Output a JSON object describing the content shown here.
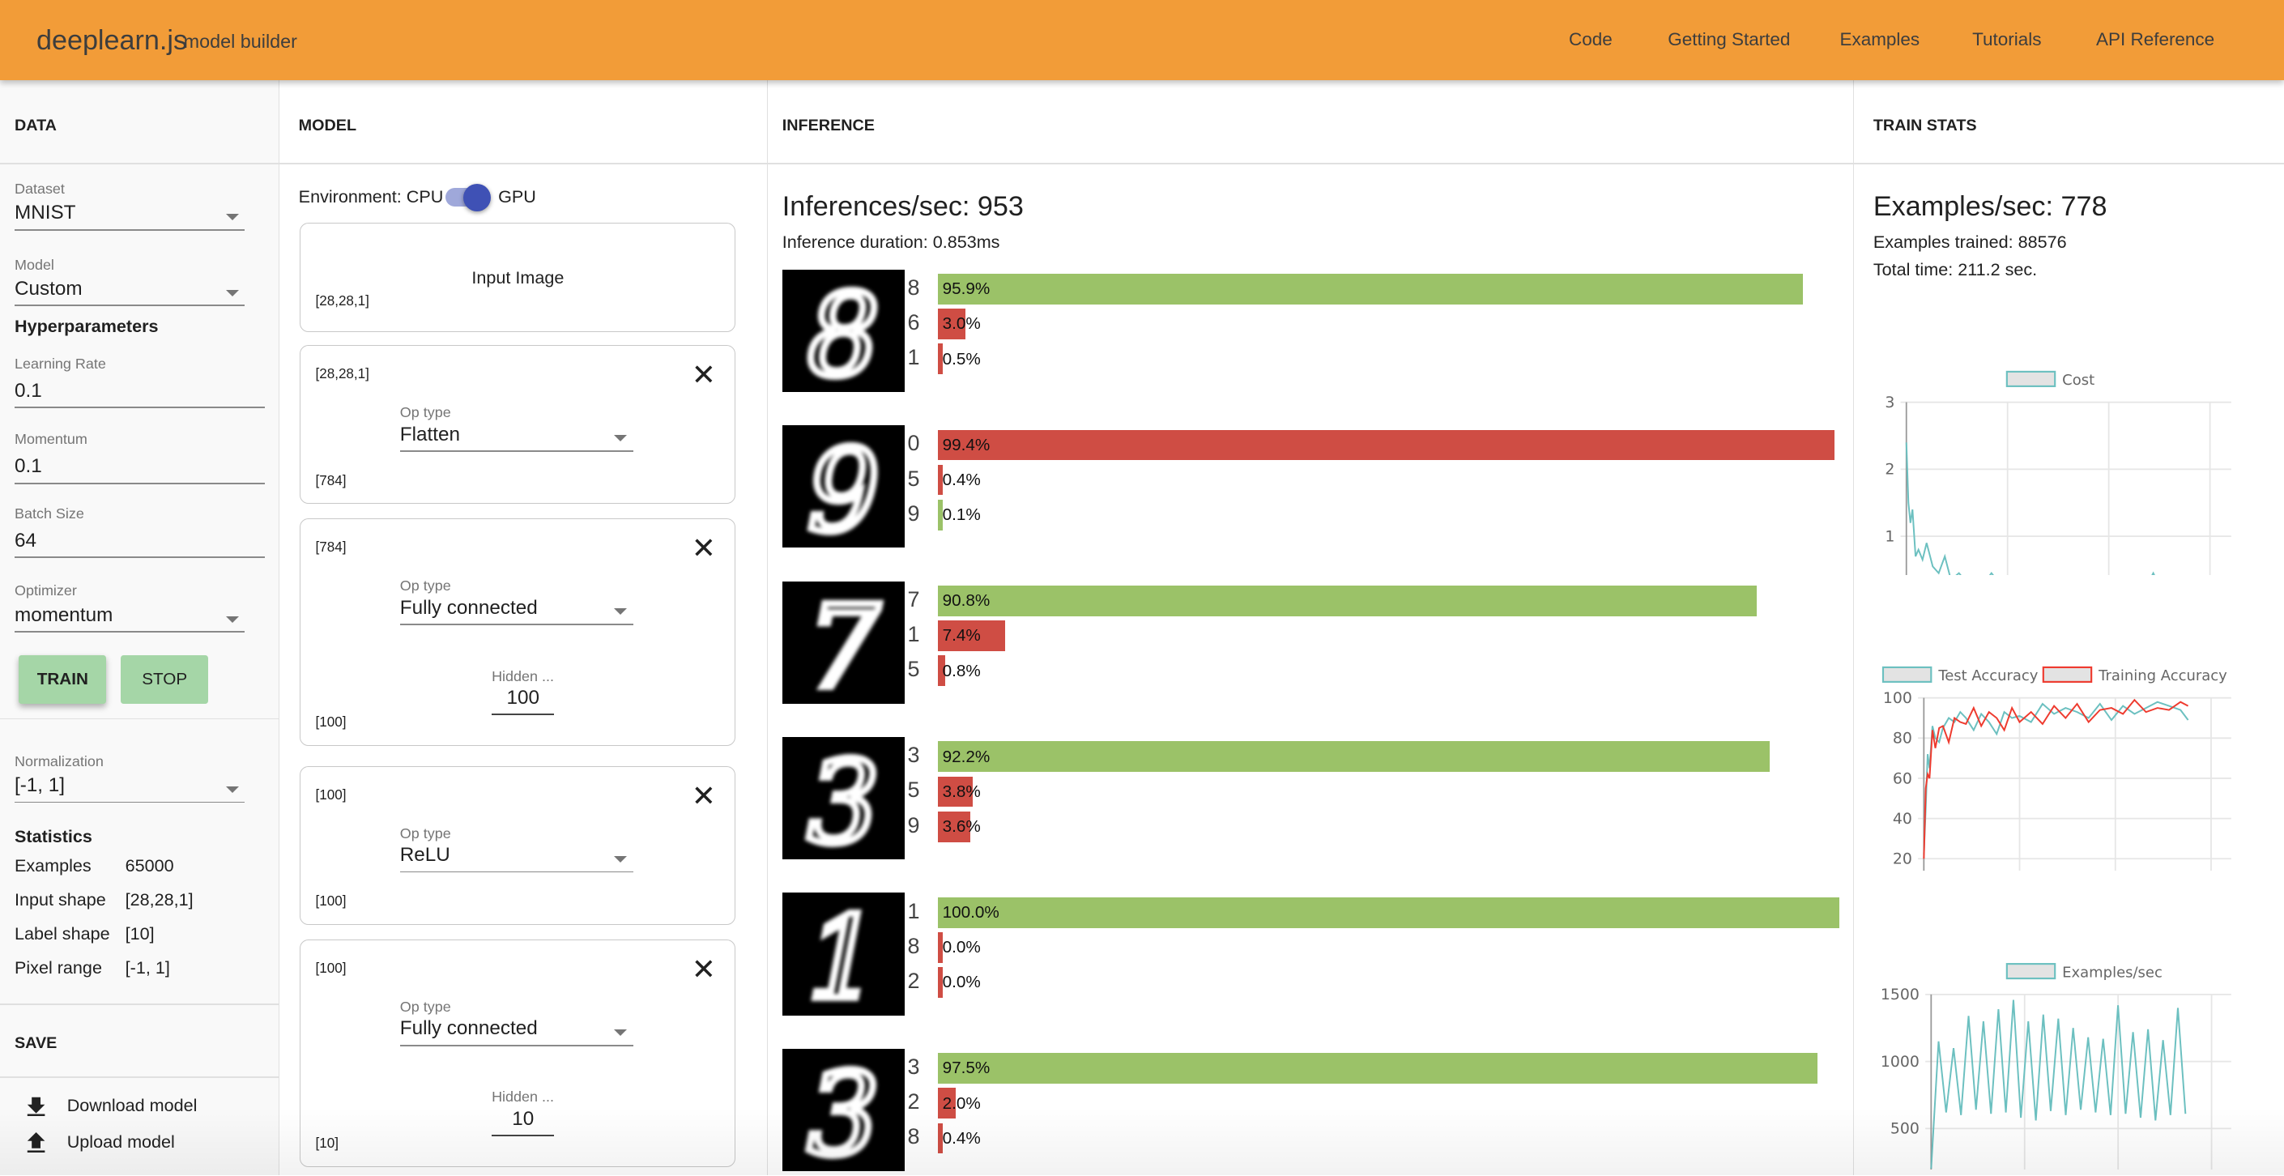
{
  "header": {
    "brand": "deeplearn.js",
    "subtitle": "model builder",
    "nav": [
      "Code",
      "Getting Started",
      "Examples",
      "Tutorials",
      "API Reference"
    ],
    "color": "#f29c38"
  },
  "data_panel": {
    "title": "DATA",
    "dataset": {
      "label": "Dataset",
      "value": "MNIST"
    },
    "model": {
      "label": "Model",
      "value": "Custom"
    },
    "hyper_title": "Hyperparameters",
    "learning_rate": {
      "label": "Learning Rate",
      "value": "0.1"
    },
    "momentum": {
      "label": "Momentum",
      "value": "0.1"
    },
    "batch_size": {
      "label": "Batch Size",
      "value": "64"
    },
    "optimizer": {
      "label": "Optimizer",
      "value": "momentum"
    },
    "train_label": "TRAIN",
    "stop_label": "STOP",
    "normalization": {
      "label": "Normalization",
      "value": "[-1, 1]"
    },
    "stats_title": "Statistics",
    "stats": [
      {
        "k": "Examples",
        "v": "65000"
      },
      {
        "k": "Input shape",
        "v": "[28,28,1]"
      },
      {
        "k": "Label shape",
        "v": "[10]"
      },
      {
        "k": "Pixel range",
        "v": "[-1, 1]"
      }
    ],
    "save_title": "SAVE",
    "download_label": "Download model",
    "upload_label": "Upload model"
  },
  "model_panel": {
    "title": "MODEL",
    "env_label": "Environment: CPU",
    "env_gpu": "GPU",
    "env_gpu_on": true,
    "input_card": {
      "title": "Input Image",
      "shape": "[28,28,1]"
    },
    "op_label": "Op type",
    "hidden_label": "Hidden ...",
    "layers": [
      {
        "in": "[28,28,1]",
        "op": "Flatten",
        "out": "[784]"
      },
      {
        "in": "[784]",
        "op": "Fully connected",
        "hidden": "100",
        "out": "[100]"
      },
      {
        "in": "[100]",
        "op": "ReLU",
        "out": "[100]"
      },
      {
        "in": "[100]",
        "op": "Fully connected",
        "hidden": "10",
        "out": "[10]"
      }
    ]
  },
  "inference_panel": {
    "title": "INFERENCE",
    "rate": "Inferences/sec: 953",
    "duration": "Inference duration: 0.853ms",
    "colors": {
      "correct": "#9bc268",
      "wrong": "#cf4d44"
    },
    "rows": [
      {
        "digit": "8",
        "preds": [
          {
            "label": "8",
            "pct": 95.9,
            "text": "95.9%",
            "correct": true
          },
          {
            "label": "6",
            "pct": 3.0,
            "text": "3.0%",
            "correct": false
          },
          {
            "label": "1",
            "pct": 0.5,
            "text": "0.5%",
            "correct": false
          }
        ]
      },
      {
        "digit": "9",
        "preds": [
          {
            "label": "0",
            "pct": 99.4,
            "text": "99.4%",
            "correct": false
          },
          {
            "label": "5",
            "pct": 0.4,
            "text": "0.4%",
            "correct": false
          },
          {
            "label": "9",
            "pct": 0.1,
            "text": "0.1%",
            "correct": true
          }
        ]
      },
      {
        "digit": "7",
        "preds": [
          {
            "label": "7",
            "pct": 90.8,
            "text": "90.8%",
            "correct": true
          },
          {
            "label": "1",
            "pct": 7.4,
            "text": "7.4%",
            "correct": false
          },
          {
            "label": "5",
            "pct": 0.8,
            "text": "0.8%",
            "correct": false
          }
        ]
      },
      {
        "digit": "3",
        "preds": [
          {
            "label": "3",
            "pct": 92.2,
            "text": "92.2%",
            "correct": true
          },
          {
            "label": "5",
            "pct": 3.8,
            "text": "3.8%",
            "correct": false
          },
          {
            "label": "9",
            "pct": 3.6,
            "text": "3.6%",
            "correct": false
          }
        ]
      },
      {
        "digit": "1",
        "preds": [
          {
            "label": "1",
            "pct": 100.0,
            "text": "100.0%",
            "correct": true
          },
          {
            "label": "8",
            "pct": 0.0,
            "text": "0.0%",
            "correct": false
          },
          {
            "label": "2",
            "pct": 0.0,
            "text": "0.0%",
            "correct": false
          }
        ]
      },
      {
        "digit": "3",
        "preds": [
          {
            "label": "3",
            "pct": 97.5,
            "text": "97.5%",
            "correct": true
          },
          {
            "label": "2",
            "pct": 2.0,
            "text": "2.0%",
            "correct": false
          },
          {
            "label": "8",
            "pct": 0.4,
            "text": "0.4%",
            "correct": false
          }
        ]
      }
    ]
  },
  "stats_panel": {
    "title": "TRAIN STATS",
    "rate": "Examples/sec: 778",
    "trained": "Examples trained: 88576",
    "time": "Total time: 211.2 sec."
  },
  "chart_data": [
    {
      "type": "line",
      "xlim": [
        0,
        1500
      ],
      "ylim": [
        0,
        3
      ],
      "xticks": [
        "0",
        "500",
        "1000",
        "1500"
      ],
      "yticks": [
        "0",
        "1",
        "2",
        "3"
      ],
      "grid": true,
      "legend": "top",
      "series": [
        {
          "name": "Cost",
          "color": "#6cc0c0",
          "x": [
            0,
            10,
            20,
            30,
            45,
            60,
            80,
            100,
            130,
            160,
            190,
            220,
            260,
            300,
            340,
            380,
            420,
            460,
            500,
            540,
            580,
            620,
            660,
            700,
            740,
            780,
            820,
            860,
            900,
            940,
            980,
            1020,
            1060,
            1100,
            1140,
            1180,
            1220,
            1260,
            1300,
            1340,
            1380
          ],
          "y": [
            2.4,
            1.5,
            1.2,
            1.4,
            0.7,
            0.8,
            0.65,
            0.9,
            0.55,
            0.45,
            0.7,
            0.35,
            0.45,
            0.3,
            0.4,
            0.28,
            0.45,
            0.3,
            0.25,
            0.4,
            0.22,
            0.38,
            0.25,
            0.3,
            0.2,
            0.35,
            0.18,
            0.3,
            0.22,
            0.3,
            0.15,
            0.35,
            0.2,
            0.25,
            0.18,
            0.22,
            0.45,
            0.2,
            0.1,
            0.25,
            0.15
          ]
        }
      ]
    },
    {
      "type": "line",
      "xlim": [
        0,
        1500
      ],
      "ylim": [
        0,
        100
      ],
      "xticks": [
        "0",
        "500",
        "1000",
        "1500"
      ],
      "yticks": [
        "0",
        "20",
        "40",
        "60",
        "80",
        "100"
      ],
      "grid": true,
      "legend": "top",
      "series": [
        {
          "name": "Test Accuracy",
          "color": "#6cc0c0",
          "x": [
            0,
            10,
            20,
            30,
            45,
            60,
            80,
            100,
            130,
            160,
            190,
            220,
            260,
            300,
            340,
            380,
            420,
            460,
            500,
            560,
            620,
            680,
            740,
            800,
            860,
            920,
            980,
            1040,
            1100,
            1160,
            1220,
            1280,
            1340,
            1380
          ],
          "y": [
            22,
            45,
            72,
            65,
            86,
            80,
            78,
            85,
            90,
            88,
            93,
            90,
            84,
            92,
            88,
            82,
            93,
            90,
            91,
            88,
            97,
            92,
            95,
            93,
            90,
            97,
            89,
            96,
            92,
            95,
            98,
            96,
            94,
            89
          ]
        },
        {
          "name": "Training Accuracy",
          "color": "#ee3b2f",
          "x": [
            0,
            10,
            20,
            30,
            45,
            60,
            80,
            100,
            130,
            160,
            190,
            220,
            260,
            300,
            340,
            380,
            420,
            460,
            500,
            560,
            620,
            680,
            740,
            800,
            860,
            920,
            980,
            1040,
            1100,
            1160,
            1220,
            1280,
            1340,
            1380
          ],
          "y": [
            20,
            55,
            62,
            60,
            84,
            75,
            85,
            86,
            78,
            90,
            88,
            87,
            95,
            86,
            93,
            90,
            84,
            95,
            88,
            93,
            87,
            96,
            90,
            97,
            88,
            94,
            95,
            92,
            99,
            93,
            95,
            94,
            98,
            96
          ]
        }
      ]
    },
    {
      "type": "line",
      "xlim": [
        0,
        1500
      ],
      "ylim": [
        0,
        1500
      ],
      "xticks": [
        "0",
        "500",
        "1000",
        "1500"
      ],
      "yticks": [
        "0",
        "500",
        "1000",
        "1500"
      ],
      "grid": true,
      "legend": "top",
      "series": [
        {
          "name": "Examples/sec",
          "color": "#6cc0c0",
          "x": [
            0,
            40,
            80,
            120,
            160,
            200,
            240,
            280,
            320,
            360,
            400,
            440,
            480,
            520,
            560,
            600,
            640,
            680,
            720,
            760,
            800,
            840,
            880,
            920,
            960,
            1000,
            1040,
            1080,
            1120,
            1160,
            1200,
            1240,
            1280,
            1320,
            1360
          ],
          "y": [
            200,
            1150,
            620,
            1100,
            600,
            1340,
            640,
            1300,
            610,
            1390,
            620,
            1460,
            580,
            1300,
            560,
            1350,
            630,
            1320,
            600,
            1250,
            640,
            1180,
            620,
            1170,
            600,
            1420,
            610,
            1220,
            580,
            1240,
            560,
            1160,
            600,
            1400,
            610
          ]
        }
      ]
    }
  ]
}
